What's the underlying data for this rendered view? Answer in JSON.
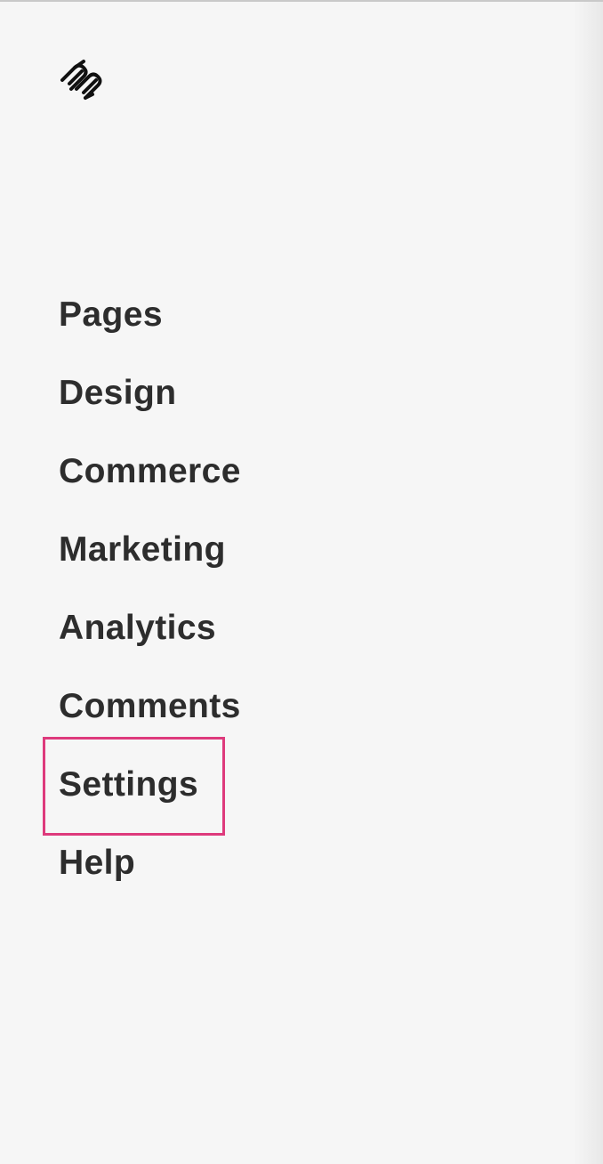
{
  "logo": {
    "icon": "squarespace-logo-icon"
  },
  "nav": {
    "items": [
      {
        "label": "Pages"
      },
      {
        "label": "Design"
      },
      {
        "label": "Commerce"
      },
      {
        "label": "Marketing"
      },
      {
        "label": "Analytics"
      },
      {
        "label": "Comments"
      },
      {
        "label": "Settings",
        "highlighted": true
      },
      {
        "label": "Help"
      }
    ]
  },
  "colors": {
    "background": "#f6f6f6",
    "text": "#2d2d2d",
    "highlight": "#de3a7c"
  }
}
